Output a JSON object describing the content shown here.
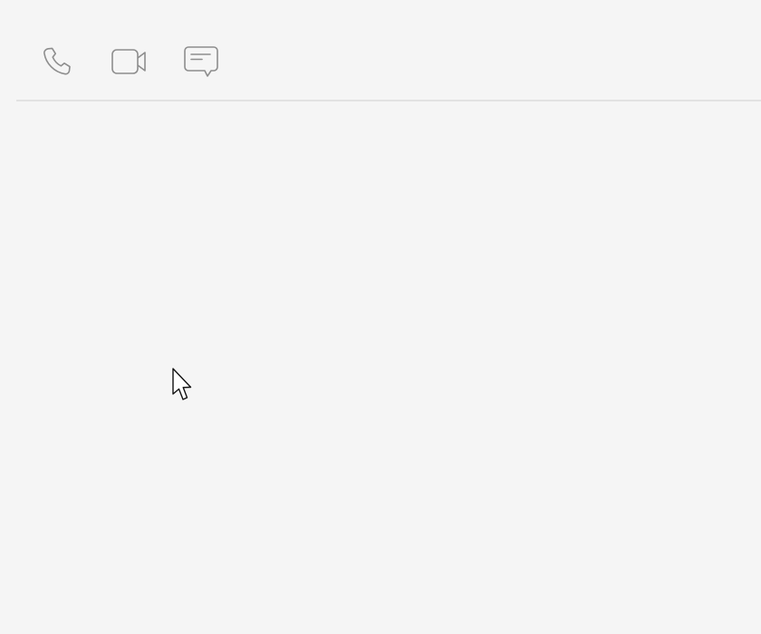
{
  "colors": {
    "background": "#f5f5f5",
    "divider": "#e2e2e2",
    "icon_stroke": "#8d8d8d"
  },
  "toolbar": {
    "buttons": [
      {
        "icon": "phone-icon"
      },
      {
        "icon": "video-camera-icon"
      },
      {
        "icon": "chat-bubble-icon"
      }
    ]
  },
  "cursor": {
    "icon": "mouse-pointer-icon"
  }
}
